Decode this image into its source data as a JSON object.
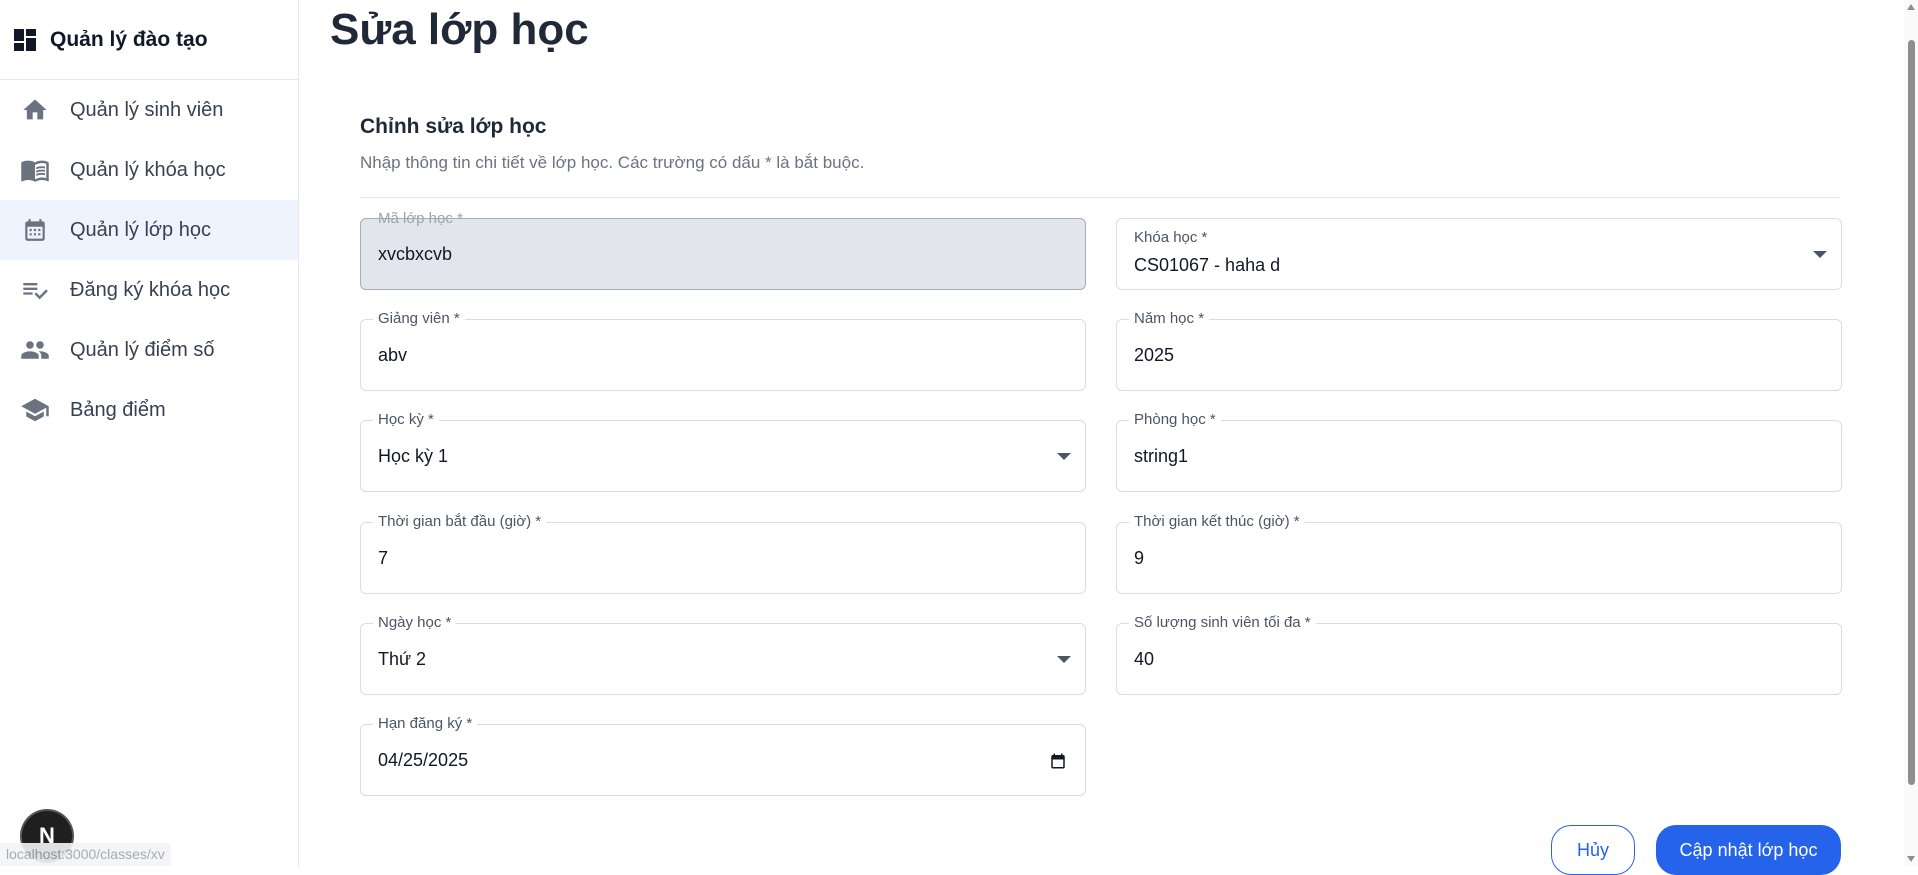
{
  "app": {
    "title": "Quản lý đào tạo",
    "logo_icon": "dashboard-icon"
  },
  "sidebar": {
    "items": [
      {
        "label": "Quản lý sinh viên",
        "icon": "home-icon",
        "active": false
      },
      {
        "label": "Quản lý khóa học",
        "icon": "book-icon",
        "active": false
      },
      {
        "label": "Quản lý lớp học",
        "icon": "calendar-icon",
        "active": true
      },
      {
        "label": "Đăng ký khóa học",
        "icon": "checklist-icon",
        "active": false
      },
      {
        "label": "Quản lý điểm số",
        "icon": "people-icon",
        "active": false
      },
      {
        "label": "Bảng điểm",
        "icon": "school-icon",
        "active": false
      }
    ]
  },
  "page": {
    "title": "Sửa lớp học"
  },
  "form": {
    "title": "Chỉnh sửa lớp học",
    "description": "Nhập thông tin chi tiết về lớp học. Các trường có dấu * là bắt buộc.",
    "fields": {
      "class_code": {
        "label": "Mã lớp học *",
        "value": "xvcbxcvb",
        "disabled": true
      },
      "course": {
        "label": "Khóa học *",
        "value": "CS01067 - haha d"
      },
      "lecturer": {
        "label": "Giảng viên *",
        "value": "abv"
      },
      "year": {
        "label": "Năm học *",
        "value": "2025"
      },
      "semester": {
        "label": "Học kỳ *",
        "value": "Học kỳ 1"
      },
      "room": {
        "label": "Phòng học *",
        "value": "string1"
      },
      "start_time": {
        "label": "Thời gian bắt đầu (giờ) *",
        "value": "7"
      },
      "end_time": {
        "label": "Thời gian kết thúc (giờ) *",
        "value": "9"
      },
      "day": {
        "label": "Ngày học *",
        "value": "Thứ 2"
      },
      "max_students": {
        "label": "Số lượng sinh viên tối đa *",
        "value": "40"
      },
      "deadline": {
        "label": "Hạn đăng ký *",
        "value": "04/25/2025"
      }
    },
    "buttons": {
      "cancel": "Hủy",
      "submit": "Cập nhật lớp học"
    }
  },
  "overlay": {
    "badge": "N",
    "status_url": "localhost:3000/classes/xv"
  },
  "colors": {
    "accent": "#2563eb",
    "active_bg": "#eef3fd",
    "disabled_bg": "#e2e6ec"
  }
}
